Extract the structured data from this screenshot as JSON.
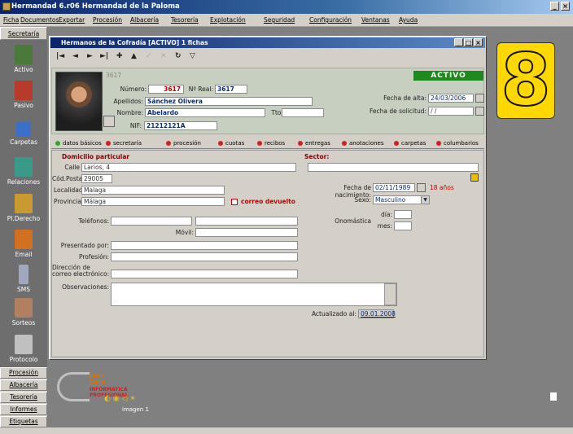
{
  "app": {
    "title": "Hermandad 6.r06  Hermandad de la Paloma",
    "controls": [
      "_",
      "×"
    ]
  },
  "menu": [
    "Ficha",
    "Documentos",
    "Exportar",
    "Procesión",
    "Albacería",
    "Tesorería",
    "Explotación",
    "Seguridad",
    "Configuración",
    "Ventanas",
    "Ayuda"
  ],
  "sidebar": {
    "header": "Secretaría",
    "items": [
      {
        "label": "Activo",
        "icon": "activo-icon",
        "color": "#4a7a3a"
      },
      {
        "label": "Pasivo",
        "icon": "pasivo-icon",
        "color": "#b83a2a"
      },
      {
        "label": "Carpetas",
        "icon": "search-icon",
        "color": "#3a70c8"
      },
      {
        "label": "Relaciones",
        "icon": "relaciones-icon",
        "color": "#3a9a8a"
      },
      {
        "label": "Pl.Derecho",
        "icon": "pl-derecho-icon",
        "color": "#c89a30"
      },
      {
        "label": "Email",
        "icon": "email-icon",
        "color": "#d07020"
      },
      {
        "label": "SMS",
        "icon": "phone-icon",
        "color": "#a0a8c0"
      },
      {
        "label": "Sorteos",
        "icon": "sorteos-icon",
        "color": "#b08060"
      },
      {
        "label": "Protocolo",
        "icon": "protocolo-icon",
        "color": "#c0c0c0"
      }
    ],
    "bottom": [
      "Procesión",
      "Albacería",
      "Tesorería",
      "Informes",
      "Etiquetas"
    ]
  },
  "window": {
    "title": "Hermanos de la Cofradía [ACTIVO] 1 fichas",
    "toolbar": [
      "|◄",
      "◄",
      "►",
      "►|",
      "✚",
      "▲",
      "✓",
      "✕",
      "↻",
      "▽"
    ],
    "header": {
      "record_id": "3617",
      "numero_label": "Número:",
      "numero": "3617",
      "nreal_label": "Nº Real:",
      "nreal": "3617",
      "apellidos_label": "Apellidos:",
      "apellidos": "Sánchez Olivera",
      "nombre_label": "Nombre:",
      "nombre": "Abelardo",
      "tto_label": "Tto:",
      "tto": "",
      "nif_label": "NIF:",
      "nif": "21212121A",
      "status": "ACTIVO",
      "fecha_alta_label": "Fecha de alta:",
      "fecha_alta": "24/03/2006",
      "fecha_solicitud_label": "Fecha de solicitud:",
      "fecha_solicitud": "  /  /"
    },
    "tabs": [
      {
        "label": "datos básicos",
        "dot": "#2ea82e"
      },
      {
        "label": "secretaría",
        "dot": "#d02020"
      },
      {
        "label": "procesión",
        "dot": "#d02020"
      },
      {
        "label": "cuotas",
        "dot": "#d02020"
      },
      {
        "label": "recibos",
        "dot": "#d02020"
      },
      {
        "label": "entregas",
        "dot": "#d02020"
      },
      {
        "label": "anotaciones",
        "dot": "#d02020"
      },
      {
        "label": "carpetas",
        "dot": "#d02020"
      },
      {
        "label": "columbarios",
        "dot": "#d02020"
      }
    ],
    "datos": {
      "domicilio_title": "Domicilio particular",
      "calle_label": "Calle",
      "calle": "Larios, 4",
      "cp_label": "Cód.Postal",
      "cp": "29005",
      "localidad_label": "Localidad",
      "localidad": "Malaga",
      "provincia_label": "Provincia",
      "provincia": "Málaga",
      "correo_devuelto": "correo devuelto",
      "sector_title": "Sector:",
      "fnac_label": "Fecha de nacimiento:",
      "fnac": "02/11/1989",
      "edad": "18 años",
      "sexo_label": "Sexo:",
      "sexo": "Masculino",
      "onomastica_label": "Onomástica",
      "dia_label": "día:",
      "mes_label": "mes:",
      "telefonos_label": "Teléfonos:",
      "movil_label": "Móvil:",
      "presentado_label": "Presentado por:",
      "profesion_label": "Profesión:",
      "email_label_1": "Dirección de",
      "email_label_2": "correo electrónico:",
      "observaciones_label": "Observaciones:",
      "actualizado_label": "Actualizado al:",
      "actualizado": "09.01.2008"
    }
  },
  "badge": "8",
  "logo": {
    "line1": "Juan",
    "line2": "Cano",
    "line3": "INFORMÁTICA",
    "line4": "PROFESIONAL",
    "caption": "imagen 1"
  }
}
